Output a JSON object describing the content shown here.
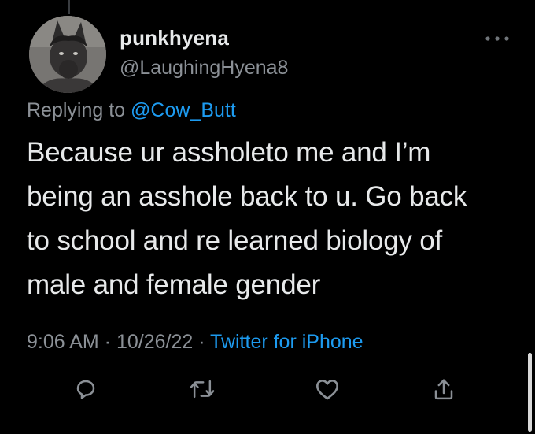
{
  "tweet": {
    "display_name": "punkhyena",
    "handle": "@LaughingHyena8",
    "replying_prefix": "Replying to ",
    "replying_to": "@Cow_Butt",
    "text": "Because ur assholeto me and I’m\nbeing an asshole back to u. Go back\nto school and re learned biology of\nmale and female gender",
    "time": "9:06 AM",
    "date": "10/26/22",
    "separator": " · ",
    "source": "Twitter for iPhone"
  },
  "icons": {
    "more": "more-dots-icon",
    "reply": "reply-icon",
    "retweet": "retweet-icon",
    "like": "heart-icon",
    "share": "share-icon"
  },
  "colors": {
    "background": "#000000",
    "text": "#e7e9ea",
    "secondary": "#8b9096",
    "link": "#1d9bf0"
  }
}
